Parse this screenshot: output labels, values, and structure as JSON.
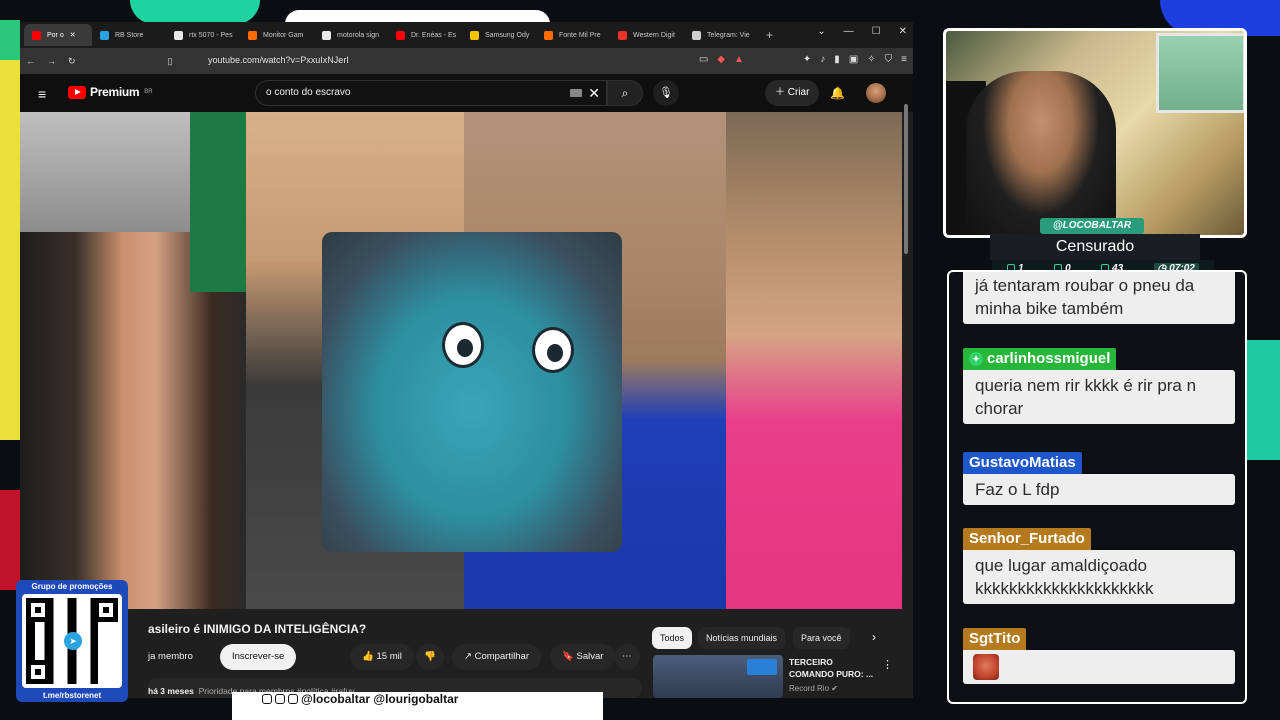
{
  "overlay": {
    "top_banner": "",
    "colors": {
      "accent_teal": "#2a9c7c",
      "blue": "#1d3fe0",
      "yellow": "#e9e03a"
    }
  },
  "browser": {
    "tabs": [
      {
        "label": "Por o",
        "icon": "youtube-icon",
        "color": "#ff0000",
        "active": true
      },
      {
        "label": "RB Store",
        "icon": "telegram-icon",
        "color": "#2aa3e0"
      },
      {
        "label": "rtx 5070 - Pes",
        "icon": "google-icon",
        "color": "#e8e8e8"
      },
      {
        "label": "Monitor Gam",
        "icon": "store-icon",
        "color": "#ff6a00"
      },
      {
        "label": "motorola sign",
        "icon": "google-icon",
        "color": "#e8e8e8"
      },
      {
        "label": "Dr. Enéas - Es",
        "icon": "youtube-icon",
        "color": "#ff0000"
      },
      {
        "label": "Samsung Ody",
        "icon": "store-icon",
        "color": "#f5c400"
      },
      {
        "label": "Fonte Mil Pre",
        "icon": "store-icon",
        "color": "#ff6a00"
      },
      {
        "label": "Western Digit",
        "icon": "shield-icon",
        "color": "#e8322a"
      },
      {
        "label": "Telegram: Vie",
        "icon": "globe-icon",
        "color": "#cccccc"
      }
    ],
    "new_tab": "+",
    "url": "youtube.com/watch?v=PxxuIxNJerI"
  },
  "youtube": {
    "logo_text": "Premium",
    "logo_region": "BR",
    "search_query": "o conto do escravo",
    "create_label": "Criar",
    "video_title": "asileiro é INIMIGO DA INTELIGÊNCIA?",
    "member_label": "ja membro",
    "subscribe_label": "Inscrever-se",
    "likes": "15 mil",
    "share_label": "Compartilhar",
    "save_label": "Salvar",
    "meta_age": "há 3 meses",
    "meta_tags": "Prioridade para membros  #política  #rafuv",
    "filters": [
      "Todos",
      "Notícias mundiais",
      "Para você"
    ],
    "reco": {
      "title": "TERCEIRO COMANDO PURO: ...",
      "channel": "Record Rio"
    }
  },
  "promo": {
    "header": "Grupo de promoções",
    "footer": "t.me/rbstorenet"
  },
  "socials_text": "@locobaltar    @lourigobaltar",
  "streamer": {
    "handle": "@LOCOBALTAR",
    "status": "Censurado",
    "stats": {
      "a": "1",
      "b": "0",
      "c": "43",
      "time": "07:02"
    }
  },
  "chat": {
    "messages": [
      {
        "user": "",
        "color": "#2a9c7c",
        "text": "já tentaram roubar o pneu da minha bike também"
      },
      {
        "user": "carlinhossmiguel",
        "color": "#27b53a",
        "text": "queria nem rir kkkk é rir pra n chorar"
      },
      {
        "user": "GustavoMatias",
        "color": "#1e57c9",
        "text": "Faz o L fdp"
      },
      {
        "user": "Senhor_Furtado",
        "color": "#b57a1d",
        "text": "que lugar amaldiçoado kkkkkkkkkkkkkkkkkkkkk"
      },
      {
        "user": "SgtTito",
        "color": "#b57a1d",
        "text": ""
      }
    ]
  }
}
